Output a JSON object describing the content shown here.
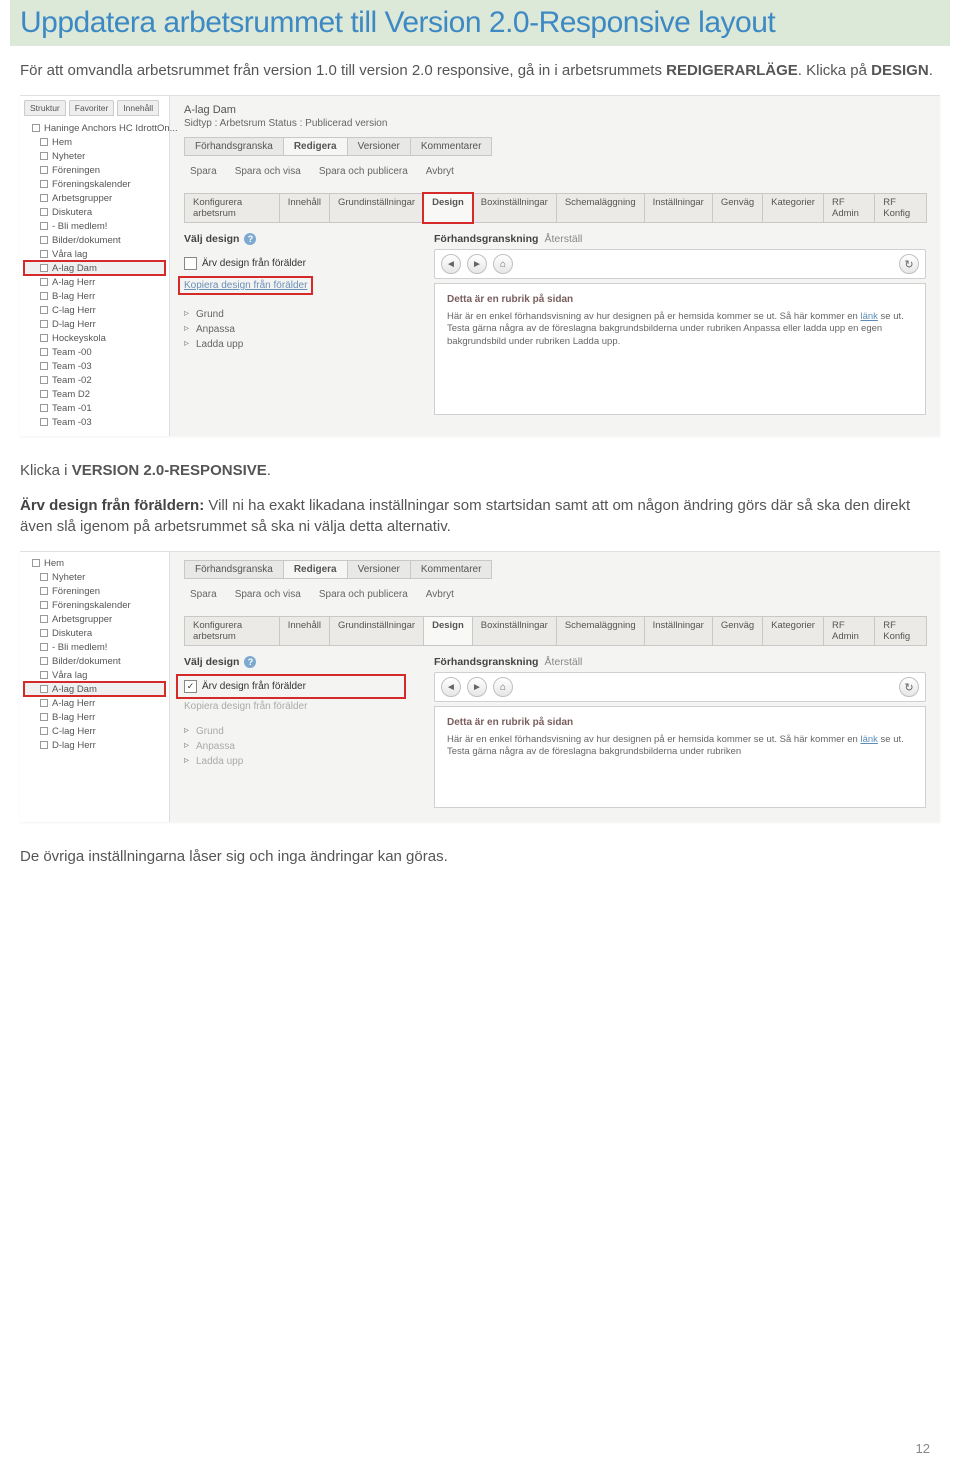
{
  "title": "Uppdatera arbetsrummet till Version 2.0-Responsive layout",
  "para1a": "För att omvandla arbetsrummet från version 1.0 till version 2.0 responsive, gå in i arbetsrummets ",
  "para1b": "REDIGERARLÄGE",
  "para1c": ". Klicka på ",
  "para1d": "DESIGN",
  "para1e": ".",
  "para2a": "Klicka i ",
  "para2b": "VERSION 2.0-RESPONSIVE",
  "para2c": ".",
  "para3a": "Ärv design från föräldern:",
  "para3b": " Vill ni ha exakt likadana inställningar som startsidan samt att om någon ändring görs där så ska den direkt även slå igenom på arbetsrummet så ska ni välja detta alternativ.",
  "para4": "De övriga inställningarna låser sig och inga ändringar kan göras.",
  "page_num": "12",
  "s1": {
    "tree_tabs": [
      "Struktur",
      "Favoriter",
      "Innehåll"
    ],
    "tree_header": "Haninge Anchors HC  IdrottOn...",
    "tree_items": [
      "Hem",
      "Nyheter",
      "Föreningen",
      "Föreningskalender",
      "Arbetsgrupper",
      "Diskutera",
      "- Bli medlem!",
      "Bilder/dokument",
      "Våra lag"
    ],
    "tree_sub": [
      "A-lag Dam",
      "A-lag Herr",
      "B-lag Herr",
      "C-lag Herr",
      "D-lag Herr",
      "Hockeyskola",
      "Team -00",
      "Team -03",
      "Team -02",
      "Team D2",
      "Team -01",
      "Team -03"
    ],
    "crumb_title": "A-lag Dam",
    "crumb_line": "Sidtyp : Arbetsrum   Status : Publicerad version",
    "top_tabs": [
      "Förhandsgranska",
      "Redigera",
      "Versioner",
      "Kommentarer"
    ],
    "act_btns": [
      "Spara",
      "Spara och visa",
      "Spara och publicera",
      "Avbryt"
    ],
    "sub_tabs": [
      "Konfigurera arbetsrum",
      "Innehåll",
      "Grundinställningar",
      "Design",
      "Boxinställningar",
      "Schemaläggning",
      "Inställningar",
      "Genväg",
      "Kategorier",
      "RF Admin",
      "RF Konfig"
    ],
    "left_hd": "Välj design",
    "chk_label": "Ärv design från förälder",
    "link_copy": "Kopiera design från förälder",
    "tri": [
      "Grund",
      "Anpassa",
      "Ladda upp"
    ],
    "right_hd": "Förhandsgranskning",
    "right_reset": "Återställ",
    "preview_title": "Detta är en rubrik på sidan",
    "preview_body_a": "Här är en enkel förhandsvisning av hur designen på er hemsida kommer se ut. Så här kommer en ",
    "preview_link": "länk",
    "preview_body_b": " se ut. Testa gärna några av de föreslagna bakgrundsbilderna under rubriken Anpassa eller ladda upp en egen bakgrundsbild under rubriken Ladda upp."
  },
  "s2": {
    "tree_items": [
      "Hem",
      "Nyheter",
      "Föreningen",
      "Föreningskalender",
      "Arbetsgrupper",
      "Diskutera",
      "- Bli medlem!",
      "Bilder/dokument",
      "Våra lag"
    ],
    "tree_sub": [
      "A-lag Dam",
      "A-lag Herr",
      "B-lag Herr",
      "C-lag Herr",
      "D-lag Herr"
    ],
    "top_tabs": [
      "Förhandsgranska",
      "Redigera",
      "Versioner",
      "Kommentarer"
    ],
    "act_btns": [
      "Spara",
      "Spara och visa",
      "Spara och publicera",
      "Avbryt"
    ],
    "sub_tabs": [
      "Konfigurera arbetsrum",
      "Innehåll",
      "Grundinställningar",
      "Design",
      "Boxinställningar",
      "Schemaläggning",
      "Inställningar",
      "Genväg",
      "Kategorier",
      "RF Admin",
      "RF Konfig"
    ],
    "left_hd": "Välj design",
    "chk_label": "Ärv design från förälder",
    "link_copy": "Kopiera design från förälder",
    "tri": [
      "Grund",
      "Anpassa",
      "Ladda upp"
    ],
    "right_hd": "Förhandsgranskning",
    "right_reset": "Återställ",
    "preview_title": "Detta är en rubrik på sidan",
    "preview_body_a": "Här är en enkel förhandsvisning av hur designen på er hemsida kommer se ut. Så här kommer en ",
    "preview_link": "länk",
    "preview_body_b": " se ut. Testa gärna några av de föreslagna bakgrundsbilderna under rubriken"
  }
}
